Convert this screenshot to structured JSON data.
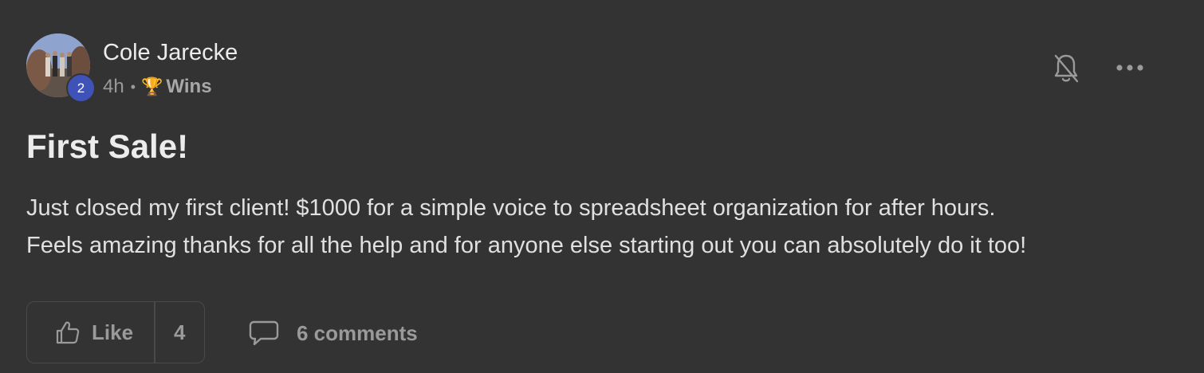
{
  "author": {
    "name": "Cole Jarecke",
    "level": "2"
  },
  "meta": {
    "time": "4h",
    "separator": "•",
    "category_icon": "🏆",
    "category": "Wins"
  },
  "post": {
    "title": "First Sale!",
    "body_lines": [
      "Just closed my first client! $1000 for a simple voice to spreadsheet organization for after hours.",
      "Feels amazing thanks for all the help and for anyone else starting out you can absolutely do it too!"
    ]
  },
  "actions": {
    "like_label": "Like",
    "like_count": "4",
    "comments_label": "6 comments"
  },
  "icons": {
    "notifications": "bell-off-icon",
    "more": "more-horizontal-icon",
    "like": "thumbs-up-icon",
    "comment": "comment-bubble-icon",
    "category": "trophy-icon"
  },
  "colors": {
    "background": "#333333",
    "level_badge": "#3f52b8",
    "muted_text": "#9a9a9a"
  }
}
